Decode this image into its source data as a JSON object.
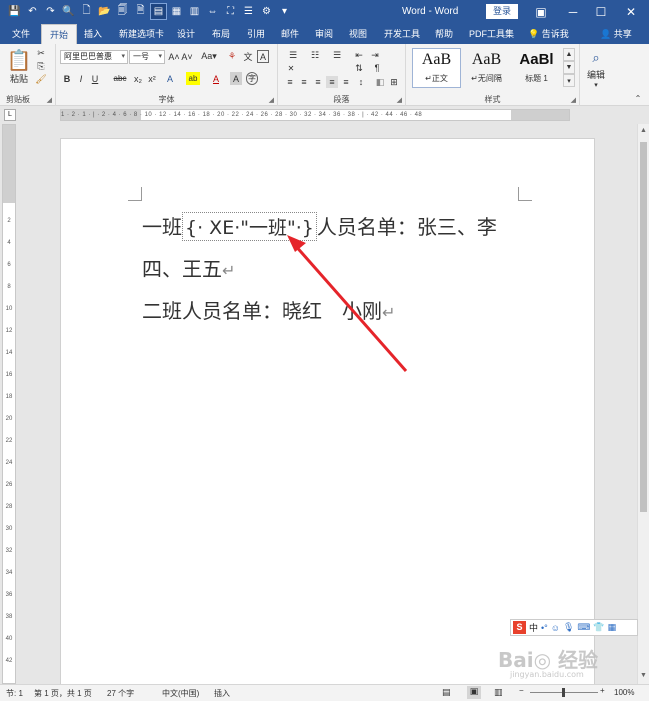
{
  "titlebar": {
    "title": "Word - Word",
    "login": "登录",
    "qat": [
      "💾",
      "↶",
      "↷",
      "🔍",
      "🗋",
      "📂",
      "🗐",
      "🗎",
      "▤",
      "▦",
      "▥",
      "⇔",
      "⛶",
      "☰",
      "⚙",
      "▾"
    ]
  },
  "tabs": [
    "文件",
    "开始",
    "插入",
    "新建选项卡",
    "设计",
    "布局",
    "引用",
    "邮件",
    "审阅",
    "视图",
    "开发工具",
    "帮助",
    "PDF工具集"
  ],
  "active_tab": "开始",
  "tellme": "告诉我",
  "share": "共享",
  "ribbon": {
    "clipboard": {
      "paste": "粘贴",
      "label": "剪贴板"
    },
    "font": {
      "name": "阿里巴巴普惠",
      "size": "一号",
      "label": "字体",
      "row1": [
        "A˄",
        "A˅",
        "Aa▾",
        "⚘",
        "文",
        "A"
      ],
      "row2": [
        "B",
        "I",
        "U",
        "abc",
        "x₂",
        "x²",
        "A",
        "ab",
        "A",
        "A",
        "字"
      ]
    },
    "paragraph": {
      "label": "段落"
    },
    "styles": {
      "label": "样式",
      "items": [
        {
          "sample": "AaB",
          "name": "↵正文"
        },
        {
          "sample": "AaB",
          "name": "↵无间隔"
        },
        {
          "sample": "AaBl",
          "name": "标题 1"
        }
      ]
    },
    "editing": {
      "label": "编辑"
    }
  },
  "ruler": {
    "h_ticks": "1 · 2 · 1 · | · 2 · 4 · 6 · 8 · 10 · 12 · 14 · 16 · 18 · 20 · 22 · 24 · 26 · 28 · 30 · 32 · 34 · 36 · 38 · | · 42 · 44 · 46 · 48",
    "v_ticks": [
      "2",
      "4",
      "6",
      "8",
      "10",
      "12",
      "14",
      "16",
      "18",
      "20",
      "22",
      "24",
      "26",
      "28",
      "30",
      "32",
      "34",
      "36",
      "38",
      "40",
      "42"
    ]
  },
  "document": {
    "line1_pre": "一班",
    "field_open": "{",
    "field_code": "· XE·\"一班\"·",
    "field_close": "}",
    "line1_post": "人员名单：张三、李",
    "line2": "四、王五",
    "line3": "二班人员名单：晓红　小刚",
    "para_mark": "↵"
  },
  "statusbar": {
    "section": "节: 1",
    "page": "第 1 页，共 1 页",
    "words": "27 个字",
    "language": "中文(中国)",
    "mode": "插入",
    "zoom": "100%"
  },
  "ime": {
    "logo": "S",
    "lang": "中"
  },
  "watermark": {
    "main": "Bai◎ 经验",
    "sub": "jingyan.baidu.com"
  }
}
